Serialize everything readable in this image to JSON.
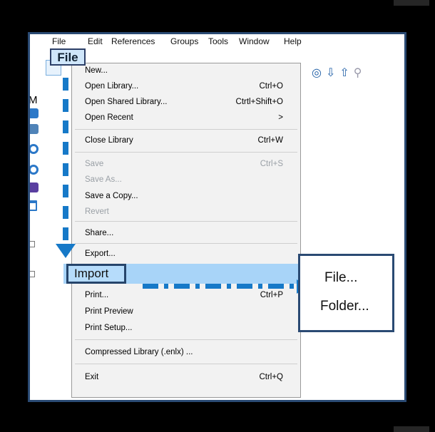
{
  "menubar": {
    "items": [
      "File",
      "Edit",
      "References",
      "Groups",
      "Tools",
      "Window",
      "Help"
    ]
  },
  "left_text": "M",
  "file_menu": {
    "rows": [
      {
        "label": "New...",
        "shortcut": "",
        "enabled": true
      },
      {
        "label": "Open Library...",
        "shortcut": "Ctrl+O",
        "enabled": true
      },
      {
        "label": "Open Shared Library...",
        "shortcut": "Ctrtl+Shift+O",
        "enabled": true
      },
      {
        "label": "Open Recent",
        "shortcut": ">",
        "enabled": true
      },
      {
        "label": "Close Library",
        "shortcut": "Ctrl+W",
        "enabled": true
      },
      {
        "label": "Save",
        "shortcut": "Ctrl+S",
        "enabled": false
      },
      {
        "label": "Save As...",
        "shortcut": "",
        "enabled": false
      },
      {
        "label": "Save a Copy...",
        "shortcut": "",
        "enabled": true
      },
      {
        "label": "Revert",
        "shortcut": "",
        "enabled": false
      },
      {
        "label": "Share...",
        "shortcut": "",
        "enabled": true
      },
      {
        "label": "Export...",
        "shortcut": "",
        "enabled": true
      },
      {
        "label": "Import",
        "shortcut": "",
        "enabled": true
      },
      {
        "label": "Print...",
        "shortcut": "Ctrl+P",
        "enabled": true
      },
      {
        "label": "Print Preview",
        "shortcut": "",
        "enabled": true
      },
      {
        "label": "Print Setup...",
        "shortcut": "",
        "enabled": true
      },
      {
        "label": "Compressed Library (.enlx) ...",
        "shortcut": "",
        "enabled": true
      },
      {
        "label": "Exit",
        "shortcut": "Ctrl+Q",
        "enabled": true
      }
    ]
  },
  "import_submenu": {
    "items": [
      "File...",
      "Folder..."
    ]
  },
  "colors": {
    "accent": "#1679c8",
    "frame": "#2a4a73",
    "highlight": "#a8d4f8"
  }
}
